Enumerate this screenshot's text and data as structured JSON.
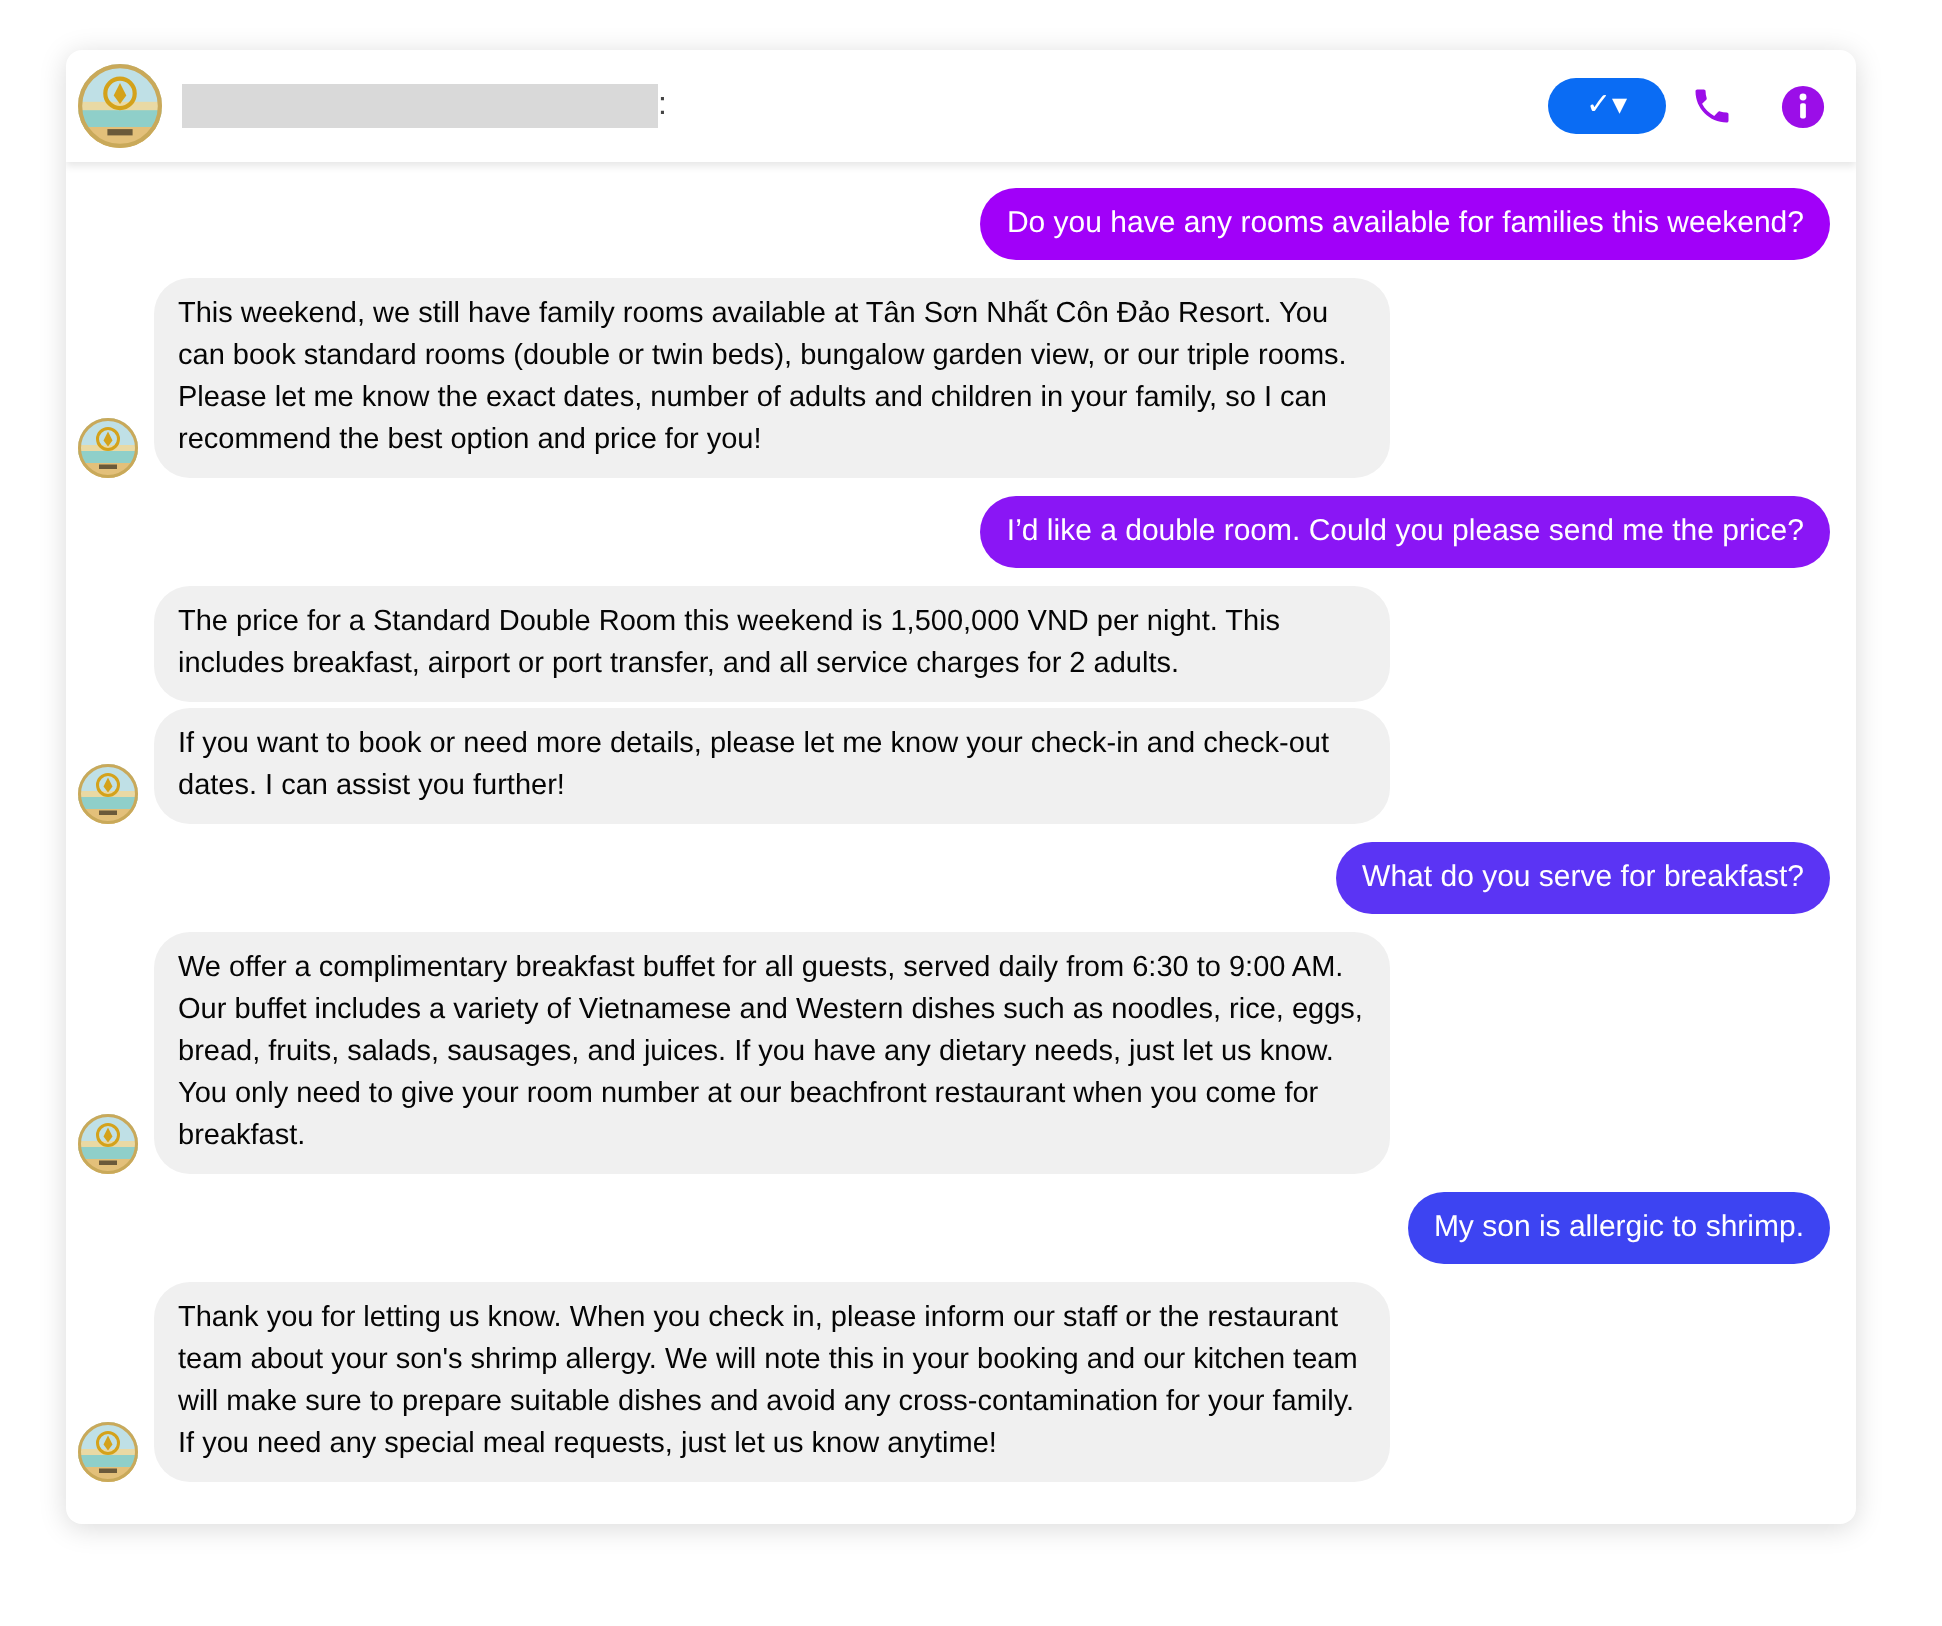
{
  "header": {
    "name_tail": ":",
    "status_button": {
      "label": "✓▾"
    }
  },
  "messages": [
    {
      "kind": "sent",
      "color": "#a100f9",
      "texts": [
        "Do you have any rooms available for families this weekend?"
      ]
    },
    {
      "kind": "received",
      "texts": [
        "This weekend, we still have family rooms available at Tân Sơn Nhất Côn Đảo Resort. You can book standard rooms (double or twin beds), bungalow garden view, or our triple rooms. Please let me know the exact dates, number of adults and children in your family, so I can recommend the best option and price for you!"
      ]
    },
    {
      "kind": "sent",
      "color": "#8a16f5",
      "texts": [
        "I’d like a double room. Could you please send me the price?"
      ]
    },
    {
      "kind": "received",
      "texts": [
        "The price for a Standard Double Room this weekend is 1,500,000 VND per night. This includes breakfast, airport or port transfer, and all service charges for 2 adults.",
        "If you want to book or need more details, please let me know your check-in and check-out dates. I can assist you further!"
      ]
    },
    {
      "kind": "sent",
      "color": "#5b34f4",
      "texts": [
        "What do you serve for breakfast?"
      ]
    },
    {
      "kind": "received",
      "texts": [
        "We offer a complimentary breakfast buffet for all guests, served daily from 6:30 to 9:00 AM. Our buffet includes a variety of Vietnamese and Western dishes such as noodles, rice, eggs, bread, fruits, salads, sausages, and juices. If you have any dietary needs, just let us know. You only need to give your room number at our beachfront restaurant when you come for breakfast."
      ]
    },
    {
      "kind": "sent",
      "color": "#3d44f2",
      "texts": [
        "My son is allergic to shrimp."
      ]
    },
    {
      "kind": "received",
      "texts": [
        "Thank you for letting us know. When you check in, please inform our staff or the restaurant team about your son's shrimp allergy. We will note this in your booking and our kitchen team will make sure to prepare suitable dishes and avoid any cross-contamination for your family. If you need any special meal requests, just let us know anytime!"
      ]
    }
  ]
}
